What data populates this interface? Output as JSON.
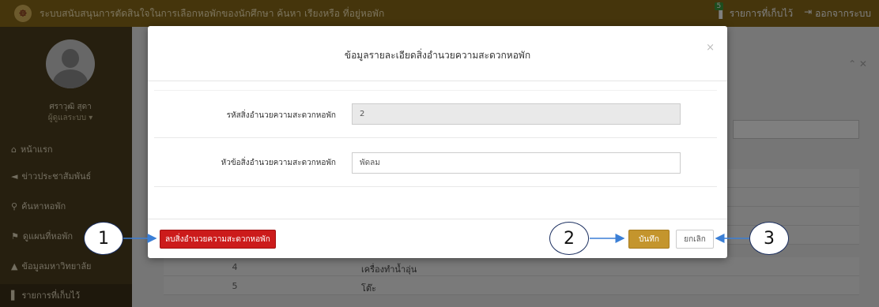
{
  "topbar": {
    "title": "ระบบสนับสนุนการตัดสินใจในการเลือกหอพักของนักศึกษา ค้นหา เรียงหรือ ที่อยู่หอพัก",
    "saved_badge": "5",
    "saved_label": "รายการที่เก็บไว้",
    "logout_label": "ออกจากระบบ"
  },
  "sidebar": {
    "user_name": "ศราวุฒิ สุดา",
    "user_role": "ผู้ดูแลระบบ ▾",
    "items": [
      {
        "label": "หน้าแรก",
        "icon": "home-icon"
      },
      {
        "label": "ข่าวประชาสัมพันธ์",
        "icon": "megaphone-icon"
      },
      {
        "label": "ค้นหาหอพัก",
        "icon": "search-icon"
      },
      {
        "label": "ดูแผนที่หอพัก",
        "icon": "map-marker-icon"
      },
      {
        "label": "ข้อมูลมหาวิทยาลัย",
        "icon": "graduation-cap-icon"
      },
      {
        "label": "รายการที่เก็บไว้",
        "icon": "bookmark-icon"
      }
    ]
  },
  "table": {
    "rows": [
      {
        "num": "4",
        "name": "เครื่องทำน้ำอุ่น"
      },
      {
        "num": "5",
        "name": "โต๊ะ"
      }
    ]
  },
  "modal": {
    "title": "ข้อมูลรายละเอียดสิ่งอำนวยความสะดวกหอพัก",
    "close_glyph": "×",
    "fields": [
      {
        "label": "รหัสสิ่งอำนวยความสะดวกหอพัก",
        "value": "2"
      },
      {
        "label": "หัวข้อสิ่งอำนวยความสะดวกหอพัก",
        "value": "พัดลม"
      }
    ],
    "delete_label": "ลบสิ่งอำนวยความสะดวกหอพัก",
    "save_label": "บันทึก",
    "cancel_label": "ยกเลิก"
  },
  "callouts": [
    "1",
    "2",
    "3"
  ],
  "colors": {
    "topbar": "#8a6a18",
    "sidebar": "#4d3f1f",
    "delete": "#cc1b1b",
    "save": "#c4952d",
    "callout_border": "#1b2f60"
  }
}
